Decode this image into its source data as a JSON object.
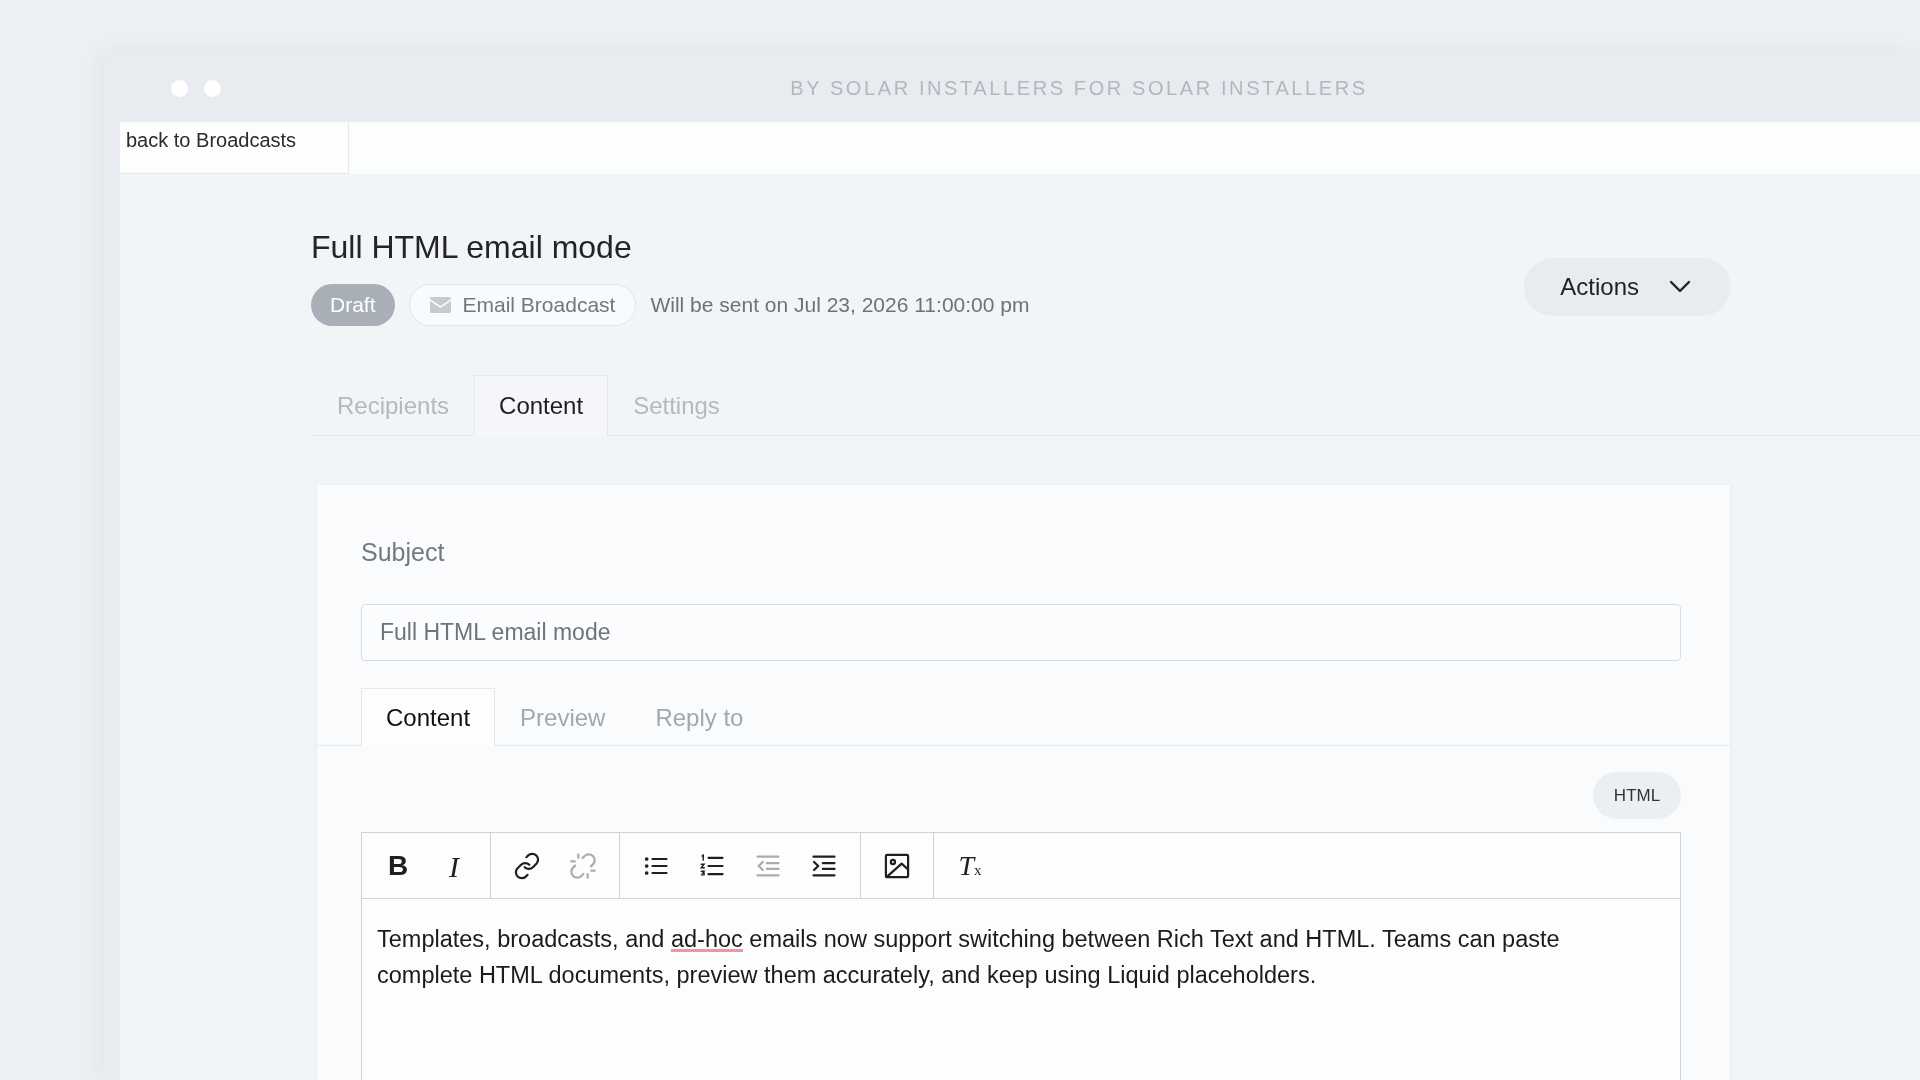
{
  "window": {
    "title": "BY SOLAR INSTALLERS FOR SOLAR INSTALLERS"
  },
  "back_link": {
    "label": "back to Broadcasts"
  },
  "header": {
    "title": "Full HTML email mode",
    "status": "Draft",
    "type": "Email Broadcast",
    "schedule": "Will be sent on Jul 23, 2026 11:00:00 pm",
    "actions": "Actions"
  },
  "tabs": [
    {
      "label": "Recipients",
      "selected": false
    },
    {
      "label": "Content",
      "selected": true
    },
    {
      "label": "Settings",
      "selected": false
    }
  ],
  "subject": {
    "label": "Subject",
    "value": "Full HTML email mode"
  },
  "content_tabs": [
    {
      "label": "Content",
      "selected": true
    },
    {
      "label": "Preview",
      "selected": false
    },
    {
      "label": "Reply to",
      "selected": false
    }
  ],
  "editor": {
    "mode_button": "HTML",
    "toolbar_groups": [
      {
        "buttons": [
          {
            "kind": "bold",
            "label": "B",
            "disabled": false
          },
          {
            "kind": "italic",
            "label": "I",
            "disabled": false
          }
        ]
      },
      {
        "buttons": [
          {
            "kind": "link",
            "disabled": false
          },
          {
            "kind": "unlink",
            "disabled": true
          }
        ]
      },
      {
        "buttons": [
          {
            "kind": "bullet_list",
            "disabled": false
          },
          {
            "kind": "numbered_list",
            "disabled": false
          },
          {
            "kind": "outdent",
            "disabled": true
          },
          {
            "kind": "indent",
            "disabled": false
          }
        ]
      },
      {
        "buttons": [
          {
            "kind": "image",
            "disabled": false
          }
        ]
      },
      {
        "buttons": [
          {
            "kind": "clear_format",
            "label": "*T*$_{x}$",
            "disabled": false
          }
        ]
      }
    ],
    "body": [
      {
        "text": "Templates, broadcasts, and ",
        "misspelled": false
      },
      {
        "text": "ad-hoc",
        "misspelled": true
      },
      {
        "text": " emails now support switching between Rich Text and HTML. Teams can paste complete HTML documents, preview them accurately, and keep using Liquid placeholders.",
        "misspelled": false
      }
    ]
  }
}
